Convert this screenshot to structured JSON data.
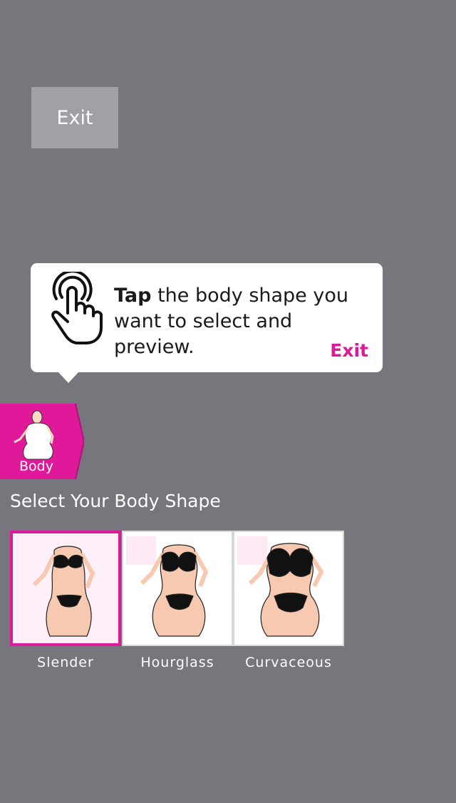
{
  "exit_button": {
    "label": "Exit"
  },
  "tooltip": {
    "bold": "Tap",
    "text": " the body shape you want to select and preview.",
    "exit_label": "Exit"
  },
  "body_tab": {
    "label": "Body"
  },
  "section": {
    "title": "Select Your Body Shape"
  },
  "shapes": [
    {
      "name": "Slender",
      "selected": true
    },
    {
      "name": "Hourglass",
      "selected": false
    },
    {
      "name": "Curvaceous",
      "selected": false
    }
  ],
  "colors": {
    "accent": "#e0189a",
    "background": "#77767c",
    "exit_bg": "#a1a0a6"
  }
}
